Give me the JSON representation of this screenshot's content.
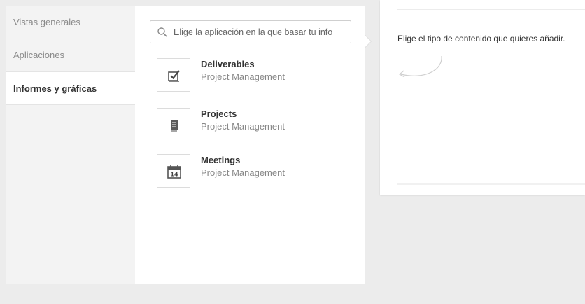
{
  "sidebar": {
    "items": [
      {
        "label": "Vistas generales",
        "active": false
      },
      {
        "label": "Aplicaciones",
        "active": false
      },
      {
        "label": "Informes y gráficas",
        "active": true
      }
    ]
  },
  "picker": {
    "search": {
      "placeholder": "Elige la aplicación en la que basar tu info",
      "value": ""
    },
    "apps": [
      {
        "name": "Deliverables",
        "workspace": "Project Management",
        "icon": "checkbox-icon"
      },
      {
        "name": "Projects",
        "workspace": "Project Management",
        "icon": "document-icon"
      },
      {
        "name": "Meetings",
        "workspace": "Project Management",
        "icon": "calendar-icon",
        "calendar_day": "14"
      }
    ]
  },
  "content": {
    "prompt": "Elige el tipo de contenido que quieres añadir."
  }
}
